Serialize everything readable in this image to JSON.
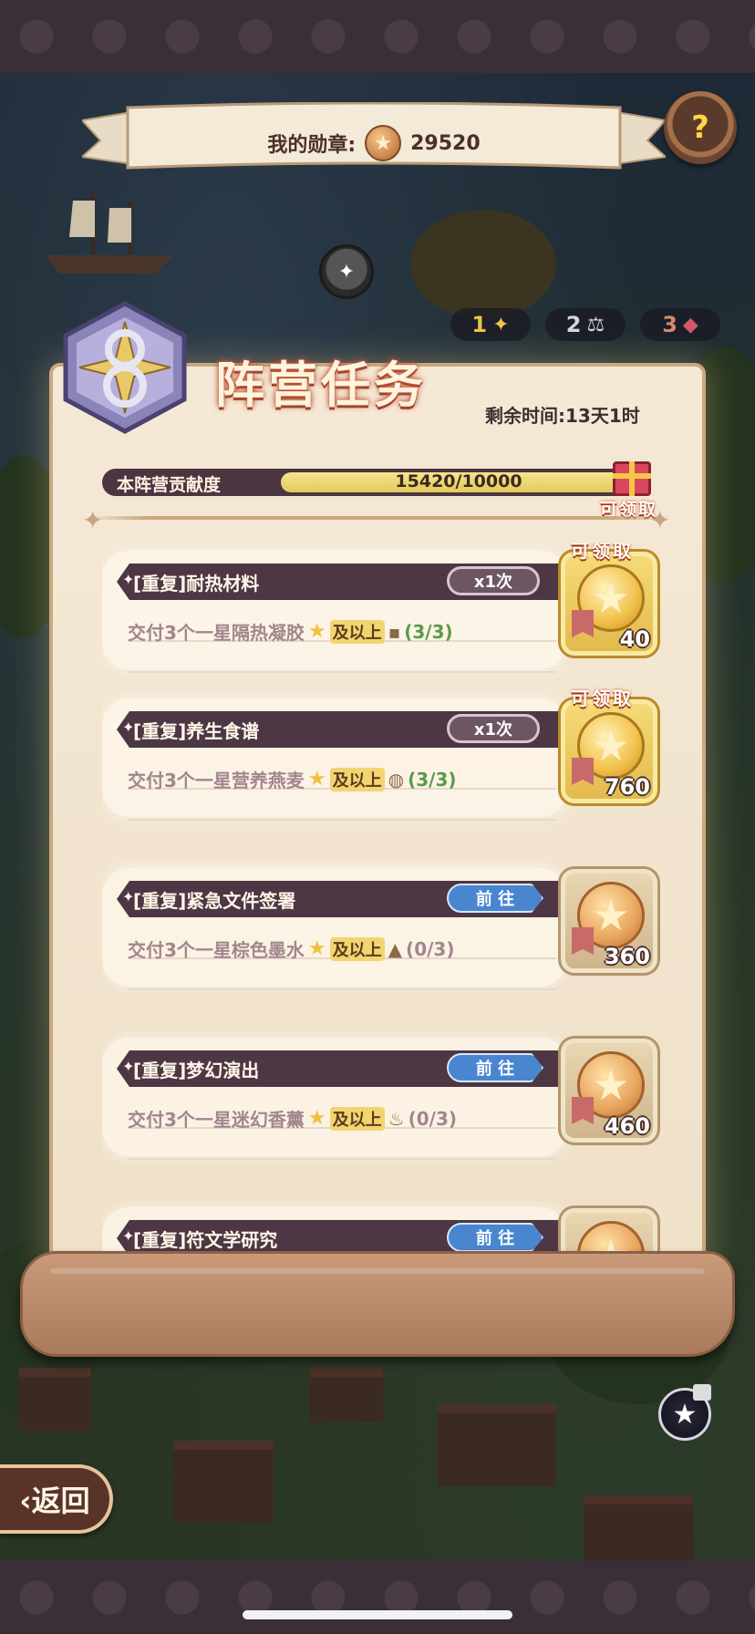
{
  "header": {
    "medals_label": "我的勋章:",
    "medals_value": "29520"
  },
  "title": "阵营任务",
  "ranks": [
    {
      "num": "1",
      "icon": "winged-emblem-icon"
    },
    {
      "num": "2",
      "icon": "scales-icon"
    },
    {
      "num": "3",
      "icon": "boar-head-icon"
    }
  ],
  "remaining_time": "剩余时间:13天1时",
  "contribution": {
    "label": "本阵营贡献度",
    "text": "15420/10000",
    "progress": 1.0,
    "claim_label": "可领取"
  },
  "tasks": [
    {
      "name": "[重复]耐热材料",
      "button": "x1次",
      "button_type": "done",
      "desc": "交付3个一星隔热凝胶",
      "above": "及以上",
      "progress": "(3/3)",
      "reward": "40",
      "claimable": "可领取"
    },
    {
      "name": "[重复]养生食谱",
      "button": "x1次",
      "button_type": "done",
      "desc": "交付3个一星营养燕麦",
      "above": "及以上",
      "progress": "(3/3)",
      "reward": "760",
      "claimable": "可领取"
    },
    {
      "name": "[重复]紧急文件签署",
      "button": "前 往",
      "button_type": "go",
      "desc": "交付3个一星棕色墨水",
      "above": "及以上",
      "progress": "(0/3)",
      "reward": "360",
      "claimable": ""
    },
    {
      "name": "[重复]梦幻演出",
      "button": "前 往",
      "button_type": "go",
      "desc": "交付3个一星迷幻香薰",
      "above": "及以上",
      "progress": "(0/3)",
      "reward": "460",
      "claimable": ""
    },
    {
      "name": "[重复]符文学研究",
      "button": "前 往",
      "button_type": "go",
      "desc": "",
      "above": "",
      "progress": "",
      "reward": "",
      "claimable": ""
    }
  ],
  "back_label": "返回",
  "help_icon": "question-icon",
  "colors": {
    "title_glow": "#c0583a",
    "go_button": "#4a86d0",
    "done_button": "#6b5661",
    "progress_done": "#5a9a4a"
  }
}
